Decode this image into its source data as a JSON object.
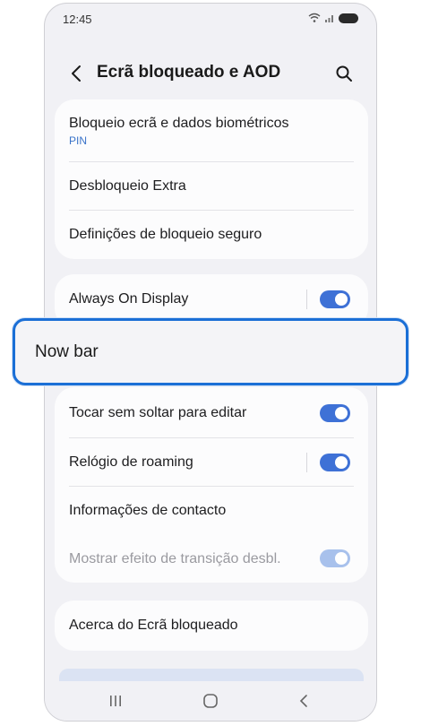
{
  "status_bar": {
    "time": "12:45"
  },
  "header": {
    "title": "Ecrã bloqueado e AOD"
  },
  "group1": [
    {
      "label": "Bloqueio ecrã e dados biométricos",
      "sub": "PIN"
    },
    {
      "label": "Desbloqueio Extra"
    },
    {
      "label": "Definições de bloqueio seguro"
    }
  ],
  "group2": {
    "always_on": {
      "label": "Always On Display",
      "on": true
    },
    "now_bar": {
      "label": "Now bar"
    },
    "tap_hold": {
      "label": "Tocar sem soltar para editar",
      "on": true
    },
    "roaming": {
      "label": "Relógio de roaming",
      "on": true
    },
    "contact": {
      "label": "Informações de contacto"
    },
    "transition": {
      "label": "Mostrar efeito de transição desbl.",
      "on": true,
      "disabled": true
    }
  },
  "about": {
    "label": "Acerca do Ecrã bloqueado"
  },
  "colors": {
    "accent": "#3e71d6",
    "highlight_border": "#1b6fd6",
    "link": "#3a73c9"
  }
}
